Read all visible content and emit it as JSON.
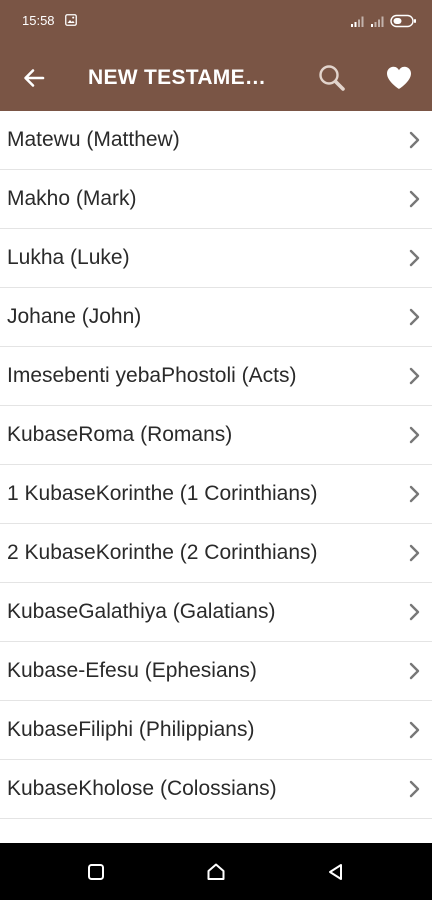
{
  "status_bar": {
    "time": "15:58",
    "colors": {
      "background": "#7a5545",
      "foreground": "#ffffff"
    },
    "icons": [
      "image-icon",
      "signal-icon",
      "wifi-icon",
      "battery-icon"
    ]
  },
  "app_bar": {
    "title": "NEW TESTAME…",
    "back_icon": "arrow-left-icon",
    "search_icon": "search-icon",
    "favorite_icon": "heart-icon",
    "colors": {
      "background": "#7a5545",
      "foreground": "#ffffff"
    }
  },
  "books": [
    {
      "label": "Matewu (Matthew)"
    },
    {
      "label": "Makho (Mark)"
    },
    {
      "label": "Lukha (Luke)"
    },
    {
      "label": "Johane (John)"
    },
    {
      "label": "Imesebenti yebaPhostoli (Acts)"
    },
    {
      "label": "KubaseRoma (Romans)"
    },
    {
      "label": "1 KubaseKorinthe (1 Corinthians)"
    },
    {
      "label": "2 KubaseKorinthe (2 Corinthians)"
    },
    {
      "label": "KubaseGalathiya (Galatians)"
    },
    {
      "label": "Kubase-Efesu (Ephesians)"
    },
    {
      "label": "KubaseFiliphi (Philippians)"
    },
    {
      "label": "KubaseKholose (Colossians)"
    }
  ],
  "list_item_icon": "chevron-right-icon",
  "nav_bar": {
    "icons": [
      "square-icon",
      "home-icon",
      "back-triangle-icon"
    ],
    "colors": {
      "background": "#000000",
      "foreground": "#ffffff"
    }
  }
}
